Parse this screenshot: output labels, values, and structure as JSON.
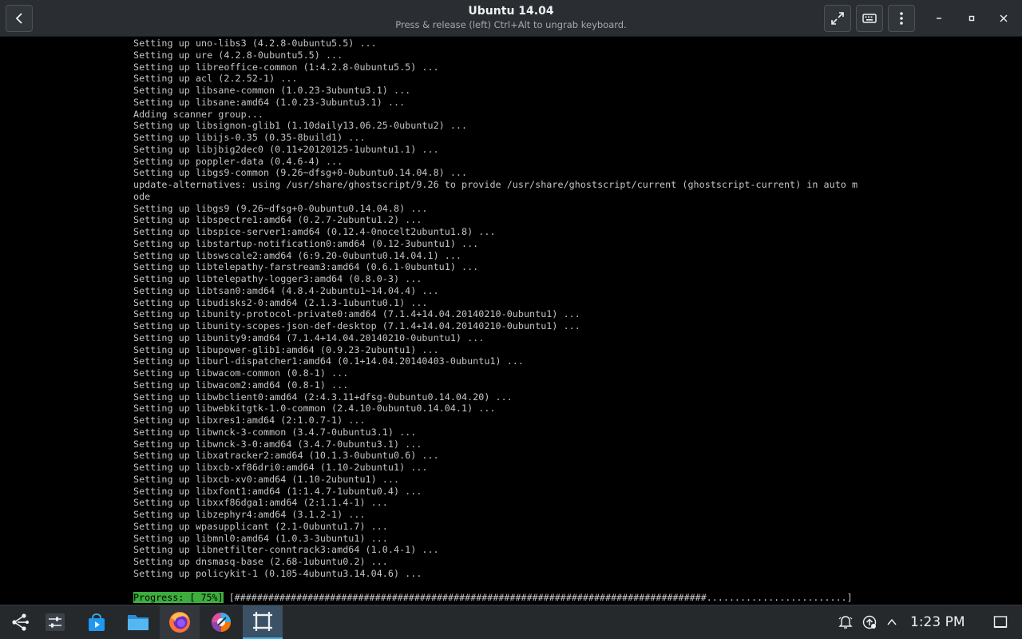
{
  "window": {
    "title": "Ubuntu 14.04",
    "subtitle": "Press & release (left) Ctrl+Alt to ungrab keyboard."
  },
  "terminal": {
    "lines": [
      "Setting up uno-libs3 (4.2.8-0ubuntu5.5) ...",
      "Setting up ure (4.2.8-0ubuntu5.5) ...",
      "Setting up libreoffice-common (1:4.2.8-0ubuntu5.5) ...",
      "Setting up acl (2.2.52-1) ...",
      "Setting up libsane-common (1.0.23-3ubuntu3.1) ...",
      "Setting up libsane:amd64 (1.0.23-3ubuntu3.1) ...",
      "Adding scanner group...",
      "Setting up libsignon-glib1 (1.10daily13.06.25-0ubuntu2) ...",
      "Setting up libijs-0.35 (0.35-8build1) ...",
      "Setting up libjbig2dec0 (0.11+20120125-1ubuntu1.1) ...",
      "Setting up poppler-data (0.4.6-4) ...",
      "Setting up libgs9-common (9.26~dfsg+0-0ubuntu0.14.04.8) ...",
      "update-alternatives: using /usr/share/ghostscript/9.26 to provide /usr/share/ghostscript/current (ghostscript-current) in auto m",
      "ode",
      "Setting up libgs9 (9.26~dfsg+0-0ubuntu0.14.04.8) ...",
      "Setting up libspectre1:amd64 (0.2.7-2ubuntu1.2) ...",
      "Setting up libspice-server1:amd64 (0.12.4-0nocelt2ubuntu1.8) ...",
      "Setting up libstartup-notification0:amd64 (0.12-3ubuntu1) ...",
      "Setting up libswscale2:amd64 (6:9.20-0ubuntu0.14.04.1) ...",
      "Setting up libtelepathy-farstream3:amd64 (0.6.1-0ubuntu1) ...",
      "Setting up libtelepathy-logger3:amd64 (0.8.0-3) ...",
      "Setting up libtsan0:amd64 (4.8.4-2ubuntu1~14.04.4) ...",
      "Setting up libudisks2-0:amd64 (2.1.3-1ubuntu0.1) ...",
      "Setting up libunity-protocol-private0:amd64 (7.1.4+14.04.20140210-0ubuntu1) ...",
      "Setting up libunity-scopes-json-def-desktop (7.1.4+14.04.20140210-0ubuntu1) ...",
      "Setting up libunity9:amd64 (7.1.4+14.04.20140210-0ubuntu1) ...",
      "Setting up libupower-glib1:amd64 (0.9.23-2ubuntu1) ...",
      "Setting up liburl-dispatcher1:amd64 (0.1+14.04.20140403-0ubuntu1) ...",
      "Setting up libwacom-common (0.8-1) ...",
      "Setting up libwacom2:amd64 (0.8-1) ...",
      "Setting up libwbclient0:amd64 (2:4.3.11+dfsg-0ubuntu0.14.04.20) ...",
      "Setting up libwebkitgtk-1.0-common (2.4.10-0ubuntu0.14.04.1) ...",
      "Setting up libxres1:amd64 (2:1.0.7-1) ...",
      "Setting up libwnck-3-common (3.4.7-0ubuntu3.1) ...",
      "Setting up libwnck-3-0:amd64 (3.4.7-0ubuntu3.1) ...",
      "Setting up libxatracker2:amd64 (10.1.3-0ubuntu0.6) ...",
      "Setting up libxcb-xf86dri0:amd64 (1.10-2ubuntu1) ...",
      "Setting up libxcb-xv0:amd64 (1.10-2ubuntu1) ...",
      "Setting up libxfont1:amd64 (1:1.4.7-1ubuntu0.4) ...",
      "Setting up libxxf86dga1:amd64 (2:1.1.4-1) ...",
      "Setting up libzephyr4:amd64 (3.1.2-1) ...",
      "Setting up wpasupplicant (2.1-0ubuntu1.7) ...",
      "Setting up libmnl0:amd64 (1.0.3-3ubuntu1) ...",
      "Setting up libnetfilter-conntrack3:amd64 (1.0.4-1) ...",
      "Setting up dnsmasq-base (2.68-1ubuntu0.2) ...",
      "Setting up policykit-1 (0.105-4ubuntu3.14.04.6) ..."
    ],
    "progress_label": "Progress: [ 75%]",
    "progress_bar": " [####################################################################################.........................]"
  },
  "progress": {
    "percent": 75
  },
  "taskbar": {
    "clock": "1:23 PM",
    "apps": [
      "application-launcher-icon",
      "system-settings-icon",
      "discover-store-icon",
      "file-manager-icon",
      "firefox-icon",
      "color-picker-icon",
      "virtual-machine-icon"
    ]
  },
  "colors": {
    "titlebar_bg": "#2a2e32",
    "taskbar_bg": "#26292c",
    "terminal_text": "#c6c6c6",
    "progress_green": "#3dad3d",
    "active_task": "#3b5266",
    "accent": "#3daee9"
  }
}
